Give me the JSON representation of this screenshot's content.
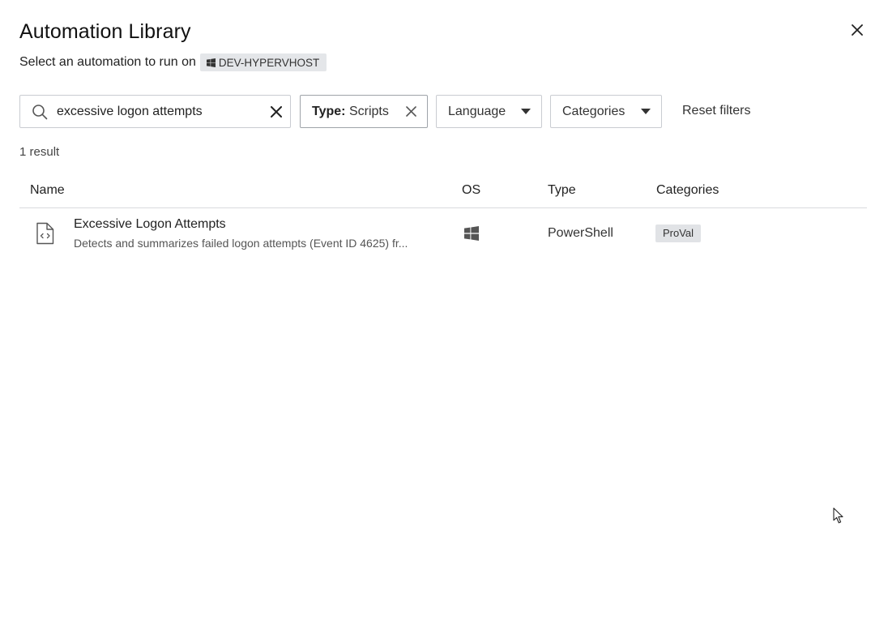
{
  "dialog": {
    "title": "Automation Library",
    "subtitle": "Select an automation to run on",
    "device_name": "DEV-HYPERVHOST"
  },
  "filters": {
    "search_value": "excessive logon attempts",
    "type_key": "Type:",
    "type_value": "Scripts",
    "language_label": "Language",
    "categories_label": "Categories",
    "reset_label": "Reset filters"
  },
  "results": {
    "count_text": "1 result"
  },
  "table": {
    "columns": [
      "Name",
      "OS",
      "Type",
      "Categories"
    ],
    "rows": [
      {
        "name": "Excessive Logon Attempts",
        "description": "Detects and summarizes failed logon attempts (Event ID 4625) fr...",
        "os": "windows-icon",
        "type": "PowerShell",
        "category": "ProVal"
      }
    ]
  },
  "icons": {
    "close": "close-icon",
    "search": "search-icon",
    "clear": "clear-icon",
    "caret": "caret-down-icon",
    "file": "code-file-icon",
    "os": "windows-icon"
  }
}
